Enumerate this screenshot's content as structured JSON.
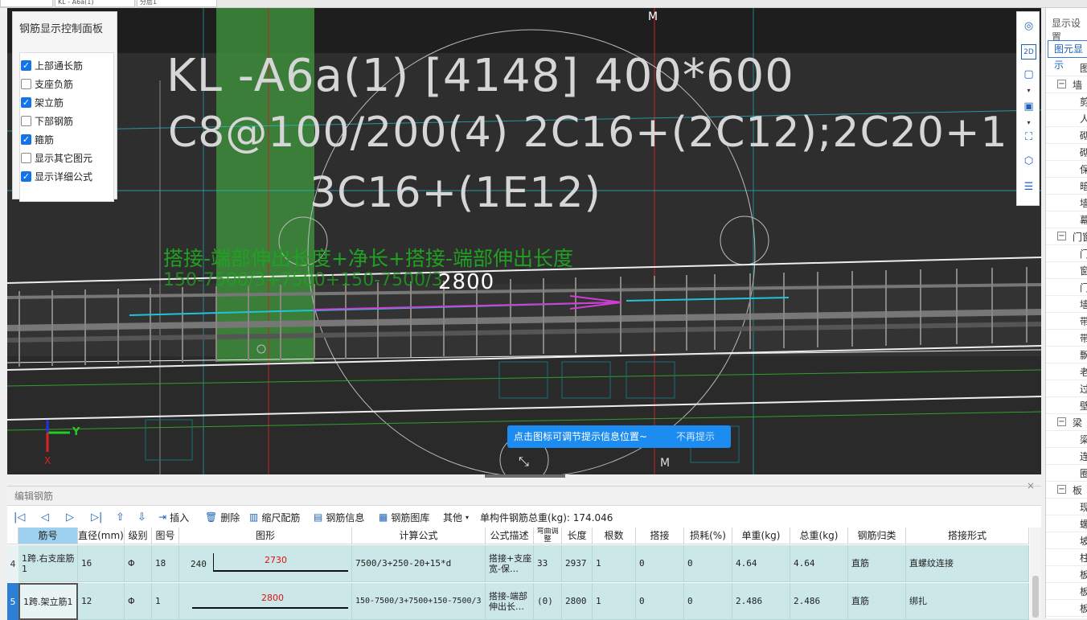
{
  "topbar": {
    "field1": "KL - A6a(1)",
    "field2": "分层1"
  },
  "viewport": {
    "beam_title": "KL -A6a(1) [4148] 400*600",
    "stirrup_line": "C8@100/200(4) 2C16+(2C12);2C20+1",
    "bottom_line": "3C16+(1E12)",
    "formula_desc": "搭接-端部伸出长度+净长+搭接-端部伸出长度",
    "formula_values": "150-7500/3+7500+150-7500/3",
    "dimension_label": "2800",
    "marker_top": "M",
    "marker_bottom": "M",
    "axis_y": "Y",
    "axis_x": "X",
    "colors": {
      "background": "#2d2d2d",
      "green_column": "#3c8c3c",
      "magenta_arrow": "#d23cd2",
      "cyan_line": "#20c4d8"
    }
  },
  "control_panel": {
    "title": "钢筋显示控制面板",
    "items": [
      {
        "label": "上部通长筋",
        "checked": true
      },
      {
        "label": "支座负筋",
        "checked": false
      },
      {
        "label": "架立筋",
        "checked": true
      },
      {
        "label": "下部钢筋",
        "checked": false
      },
      {
        "label": "箍筋",
        "checked": true
      },
      {
        "label": "显示其它图元",
        "checked": false
      },
      {
        "label": "显示详细公式",
        "checked": true
      }
    ]
  },
  "right_toolbar": {
    "icons": [
      "orbit-icon",
      "view-2d-icon",
      "view-3d-icon",
      "view-3d-solid-icon",
      "fit-view-icon",
      "cube-icon",
      "list-view-icon"
    ]
  },
  "right_panel": {
    "header": "显示设置",
    "tab": "图元显示",
    "rows": [
      {
        "kind": "sub",
        "label": "图"
      },
      {
        "kind": "group",
        "toggle": "−",
        "label": "墙"
      },
      {
        "kind": "sub",
        "label": "剪"
      },
      {
        "kind": "sub",
        "label": "人"
      },
      {
        "kind": "sub",
        "label": "砌"
      },
      {
        "kind": "sub",
        "label": "砌"
      },
      {
        "kind": "sub",
        "label": "保"
      },
      {
        "kind": "sub",
        "label": "暗"
      },
      {
        "kind": "sub",
        "label": "墙"
      },
      {
        "kind": "sub",
        "label": "幕"
      },
      {
        "kind": "group",
        "toggle": "−",
        "label": "门窗"
      },
      {
        "kind": "sub",
        "label": "门"
      },
      {
        "kind": "sub",
        "label": "窗"
      },
      {
        "kind": "sub",
        "label": "门"
      },
      {
        "kind": "sub",
        "label": "墙"
      },
      {
        "kind": "sub",
        "label": "带"
      },
      {
        "kind": "sub",
        "label": "带"
      },
      {
        "kind": "sub",
        "label": "飘"
      },
      {
        "kind": "sub",
        "label": "老"
      },
      {
        "kind": "sub",
        "label": "过"
      },
      {
        "kind": "sub",
        "label": "壁"
      },
      {
        "kind": "group",
        "toggle": "−",
        "label": "梁"
      },
      {
        "kind": "sub",
        "label": "梁"
      },
      {
        "kind": "sub",
        "label": "连"
      },
      {
        "kind": "sub",
        "label": "圈"
      },
      {
        "kind": "group",
        "toggle": "−",
        "label": "板"
      },
      {
        "kind": "sub",
        "label": "现"
      },
      {
        "kind": "sub",
        "label": "螺"
      },
      {
        "kind": "sub",
        "label": "坡"
      },
      {
        "kind": "sub",
        "label": "柱"
      },
      {
        "kind": "sub",
        "label": "板"
      },
      {
        "kind": "sub",
        "label": "板"
      },
      {
        "kind": "sub",
        "label": "板"
      }
    ]
  },
  "tip": {
    "message": "点击图标可调节提示信息位置~",
    "dismiss": "不再提示"
  },
  "editor": {
    "title": "编辑钢筋",
    "toolbar": {
      "insert": "插入",
      "delete": "删除",
      "scale_rebar": "缩尺配筋",
      "rebar_info": "钢筋信息",
      "rebar_library": "钢筋图库",
      "other": "其他",
      "total_weight": "单构件钢筋总重(kg): 174.046"
    },
    "columns": [
      "筋号",
      "直径(mm)",
      "级别",
      "图号",
      "图形",
      "计算公式",
      "公式描述",
      "弯曲调整",
      "长度",
      "根数",
      "搭接",
      "损耗(%)",
      "单重(kg)",
      "总重(kg)",
      "钢筋归类",
      "搭接形式"
    ],
    "rows": [
      {
        "index": "4",
        "name": "1跨.右支座筋1",
        "diameter": "16",
        "grade": "Φ",
        "shape_no": "18",
        "shape_left": "240",
        "shape_value": "2730",
        "formula": "7500/3+250-20+15*d",
        "desc": "搭接+支座宽-保…",
        "bend": "33",
        "length": "2937",
        "count": "1",
        "lap": "0",
        "loss": "0",
        "unit_weight": "4.64",
        "total_weight": "4.64",
        "category": "直筋",
        "lap_type": "直螺纹连接"
      },
      {
        "index": "5",
        "name": "1跨.架立筋1",
        "diameter": "12",
        "grade": "Φ",
        "shape_no": "1",
        "shape_left": "",
        "shape_value": "2800",
        "formula": "150-7500/3+7500+150-7500/3",
        "desc": "搭接-端部伸出长…",
        "bend": "(0)",
        "length": "2800",
        "count": "1",
        "lap": "0",
        "loss": "0",
        "unit_weight": "2.486",
        "total_weight": "2.486",
        "category": "直筋",
        "lap_type": "绑扎"
      }
    ]
  }
}
